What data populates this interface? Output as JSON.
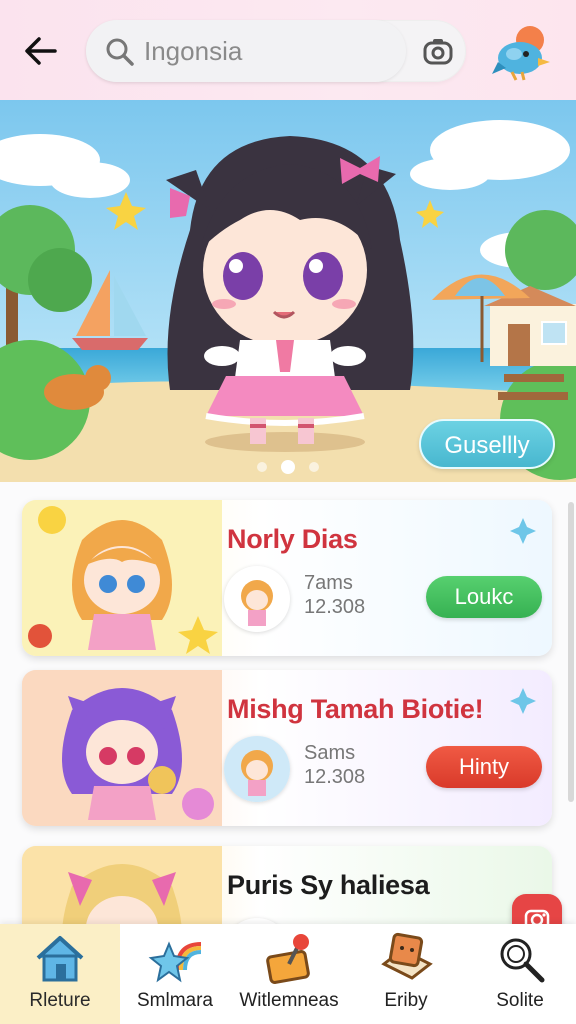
{
  "header": {
    "search_value": "Ingonsia",
    "icons": [
      "back-arrow-icon",
      "search-icon",
      "camera-lens-icon",
      "bird-avatar-icon"
    ]
  },
  "hero": {
    "button_label": "Gusellly",
    "dots": 3,
    "active_dot": 2
  },
  "cards": [
    {
      "title": "Norly Dias",
      "meta_line1": "7ams",
      "meta_line2": "12.308",
      "action_label": "Loukс",
      "action_color": "#3fbf5a"
    },
    {
      "title": "Mishg Tamah Biotie!",
      "meta_line1": "Sams",
      "meta_line2": "12.308",
      "action_label": "Hinty",
      "action_color": "#e84535"
    },
    {
      "title": "Puris Sy haliesa",
      "meta_line1": "",
      "meta_line2": "",
      "action_label": "",
      "action_color": "#3fbf5a"
    }
  ],
  "nav": {
    "items": [
      {
        "label": "Rleture",
        "icon": "home-icon",
        "active": true
      },
      {
        "label": "Smlmara",
        "icon": "rainbow-star-icon",
        "active": false
      },
      {
        "label": "Witlemneas",
        "icon": "joystick-icon",
        "active": false
      },
      {
        "label": "Eriby",
        "icon": "book-icon",
        "active": false
      },
      {
        "label": "Solite",
        "icon": "magnifier-icon",
        "active": false
      }
    ]
  },
  "colors": {
    "header_bg": "#fbe3ee",
    "title_red": "#d0343f",
    "nav_active_bg": "#fbefc6",
    "hero_button": "#52bfd6"
  }
}
